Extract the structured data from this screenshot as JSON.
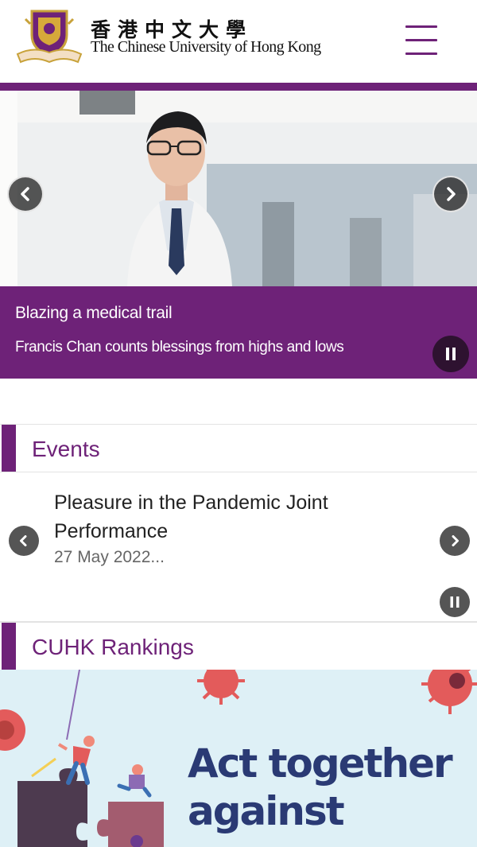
{
  "header": {
    "brand_zh": "香港中文大學",
    "brand_en": "The Chinese University of Hong Kong",
    "menu_icon": "hamburger-menu-icon",
    "brand_color": "#6e2278"
  },
  "hero": {
    "title": "Blazing a medical trail",
    "subtitle": "Francis Chan counts blessings from highs and lows",
    "prev_icon": "chevron-left-icon",
    "next_icon": "chevron-right-icon",
    "pause_icon": "pause-icon",
    "caption_color": "#6e2278"
  },
  "events": {
    "heading": "Events",
    "item": {
      "title": "Pleasure in the Pandemic Joint Performance",
      "date": "27 May 2022..."
    }
  },
  "rankings": {
    "heading": "CUHK Rankings",
    "banner_text_line1": "Act together",
    "banner_text_line2": "against",
    "banner_bg": "#def0f6",
    "banner_text_color": "#2a3a74"
  }
}
